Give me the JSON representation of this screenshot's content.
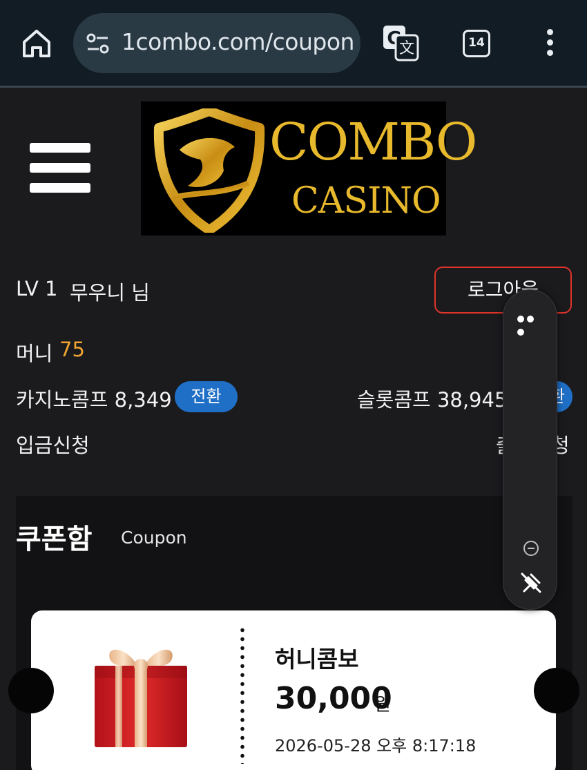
{
  "browser": {
    "url": "1combo.com/coupon",
    "tab_count": "14"
  },
  "logo": {
    "line1": "COMBO",
    "line2": "CASINO"
  },
  "user": {
    "level": "LV 1",
    "nickname": "무우니 님",
    "logout_label": "로그아웃",
    "money_label": "머니",
    "money_value": "75",
    "casino_comp": "카지노콤프 8,349",
    "slot_comp": "슬롯콤프 38,945",
    "convert_label": "전환",
    "deposit_label": "입금신청",
    "withdraw_label": "출금신청"
  },
  "coupon": {
    "title": "쿠폰함",
    "subtitle": "Coupon",
    "items": [
      {
        "name": "허니콤보",
        "amount": "30,000",
        "unit": "원",
        "date": "2026-05-28 오후 8:17:18"
      }
    ]
  },
  "colors": {
    "accent_orange": "#f0a630",
    "logout_border": "#e0342a",
    "convert_blue": "#1f6fc6",
    "logo_gold": "#e8b92c"
  },
  "icons": [
    "home-icon",
    "tune-icon",
    "translate-icon",
    "tab-count-icon",
    "more-vert-icon",
    "hamburger-menu-icon",
    "gift-icon",
    "more-horiz-icon",
    "minus-circle-icon",
    "unpin-icon"
  ]
}
